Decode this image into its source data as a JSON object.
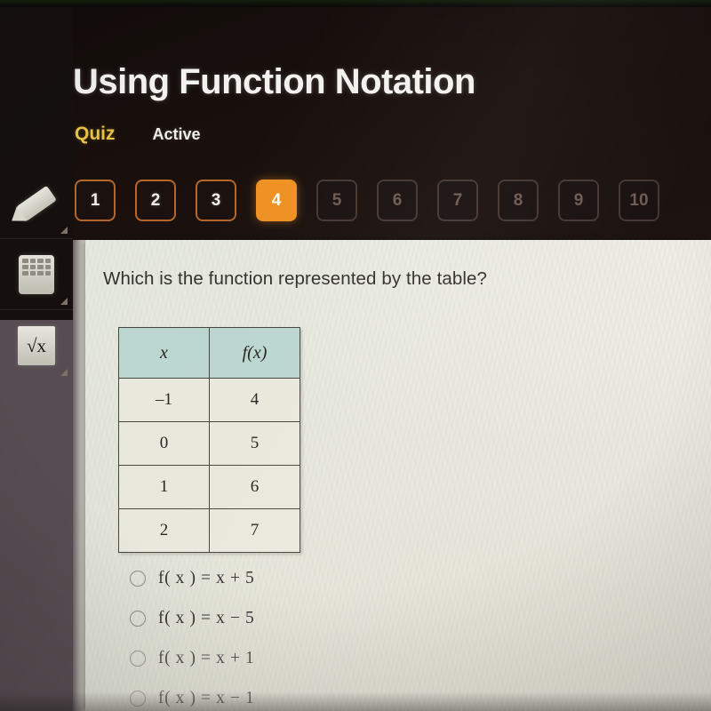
{
  "header": {
    "title": "Using Function Notation",
    "quiz_label": "Quiz",
    "status_label": "Active"
  },
  "pagination": {
    "items": [
      {
        "label": "1",
        "state": "done"
      },
      {
        "label": "2",
        "state": "done"
      },
      {
        "label": "3",
        "state": "done"
      },
      {
        "label": "4",
        "state": "current"
      },
      {
        "label": "5",
        "state": "locked"
      },
      {
        "label": "6",
        "state": "locked"
      },
      {
        "label": "7",
        "state": "locked"
      },
      {
        "label": "8",
        "state": "locked"
      },
      {
        "label": "9",
        "state": "locked"
      },
      {
        "label": "10",
        "state": "locked"
      }
    ]
  },
  "tools": [
    {
      "name": "highlighter-tool",
      "icon": "pencil-icon"
    },
    {
      "name": "calculator-tool",
      "icon": "calculator-icon"
    },
    {
      "name": "formula-tool",
      "icon": "square-root-icon",
      "glyph": "√x"
    }
  ],
  "question": {
    "prompt": "Which is the function represented by the table?"
  },
  "table": {
    "headers": [
      "x",
      "f(x)"
    ],
    "rows": [
      [
        "–1",
        "4"
      ],
      [
        "0",
        "5"
      ],
      [
        "1",
        "6"
      ],
      [
        "2",
        "7"
      ]
    ]
  },
  "options": [
    {
      "text": "f( x ) = x + 5",
      "selected": false
    },
    {
      "text": "f( x ) = x − 5",
      "selected": false
    },
    {
      "text": "f( x ) = x + 1",
      "selected": false
    },
    {
      "text": "f( x ) = x − 1",
      "selected": false
    }
  ],
  "colors": {
    "accent_orange": "#ef9123",
    "quiz_yellow": "#e8c246",
    "header_dark": "#19100d",
    "panel_cream": "#e9e7dd",
    "table_header_teal": "#bcd6d0",
    "rail_gray": "#564c51"
  }
}
